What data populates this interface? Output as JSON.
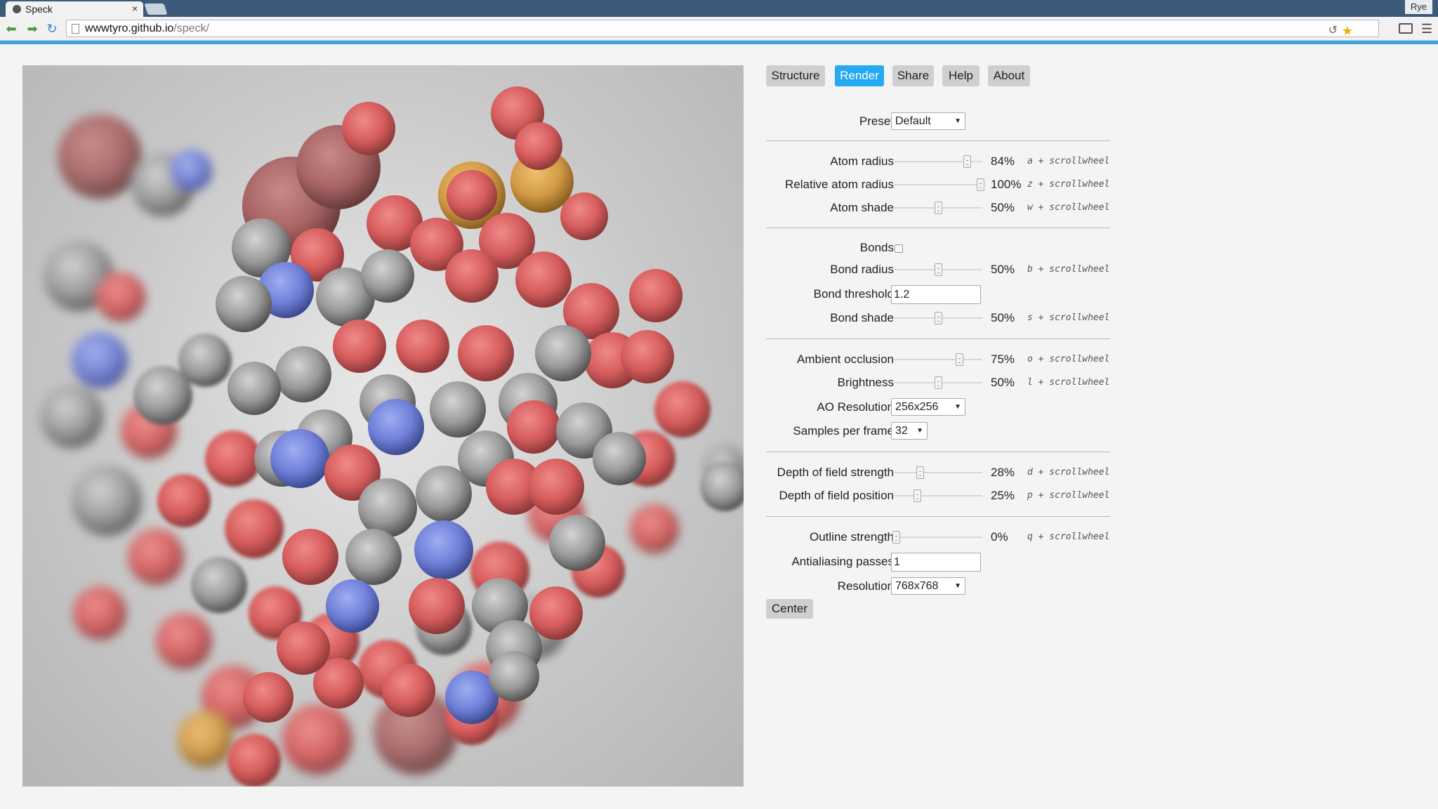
{
  "browser": {
    "tab_title": "Speck",
    "tab_close": "×",
    "user": "Rye",
    "url_host": "wwwtyro.github.io",
    "url_path": "/speck/",
    "icons": [
      "back-icon",
      "forward-icon",
      "reload-icon",
      "page-icon",
      "history-icon",
      "star-icon",
      "cast-icon",
      "menu-icon"
    ]
  },
  "nav": {
    "tabs": [
      "Structure",
      "Render",
      "Share",
      "Help",
      "About"
    ],
    "active": "Render"
  },
  "render": {
    "preset": {
      "label": "Preset",
      "value": "Default"
    },
    "atom_radius": {
      "label": "Atom radius",
      "value": 84,
      "display": "84%",
      "hint": "a + scrollwheel"
    },
    "relative_atom_radius": {
      "label": "Relative atom radius",
      "value": 100,
      "display": "100%",
      "hint": "z + scrollwheel"
    },
    "atom_shade": {
      "label": "Atom shade",
      "value": 50,
      "display": "50%",
      "hint": "w + scrollwheel"
    },
    "bonds": {
      "label": "Bonds",
      "checked": false
    },
    "bond_radius": {
      "label": "Bond radius",
      "value": 50,
      "display": "50%",
      "hint": "b + scrollwheel"
    },
    "bond_threshold": {
      "label": "Bond threshold",
      "value": "1.2"
    },
    "bond_shade": {
      "label": "Bond shade",
      "value": 50,
      "display": "50%",
      "hint": "s + scrollwheel"
    },
    "ambient_occlusion": {
      "label": "Ambient occlusion",
      "value": 75,
      "display": "75%",
      "hint": "o + scrollwheel"
    },
    "brightness": {
      "label": "Brightness",
      "value": 50,
      "display": "50%",
      "hint": "l + scrollwheel"
    },
    "ao_resolution": {
      "label": "AO Resolution",
      "value": "256x256"
    },
    "samples_per_frame": {
      "label": "Samples per frame",
      "value": "32"
    },
    "dof_strength": {
      "label": "Depth of field strength",
      "value": 28,
      "display": "28%",
      "hint": "d + scrollwheel"
    },
    "dof_position": {
      "label": "Depth of field position",
      "value": 25,
      "display": "25%",
      "hint": "p + scrollwheel"
    },
    "outline_strength": {
      "label": "Outline strength",
      "value": 0,
      "display": "0%",
      "hint": "q + scrollwheel"
    },
    "antialiasing_passes": {
      "label": "Antialiasing passes",
      "value": "1"
    },
    "resolution": {
      "label": "Resolution",
      "value": "768x768"
    },
    "center_label": "Center"
  },
  "colors": {
    "accent": "#25a9ef",
    "oxygen": "#d65c5c",
    "nitrogen": "#6f7fd8",
    "carbon": "#9a9a9a",
    "sulfur": "#d19a45"
  }
}
